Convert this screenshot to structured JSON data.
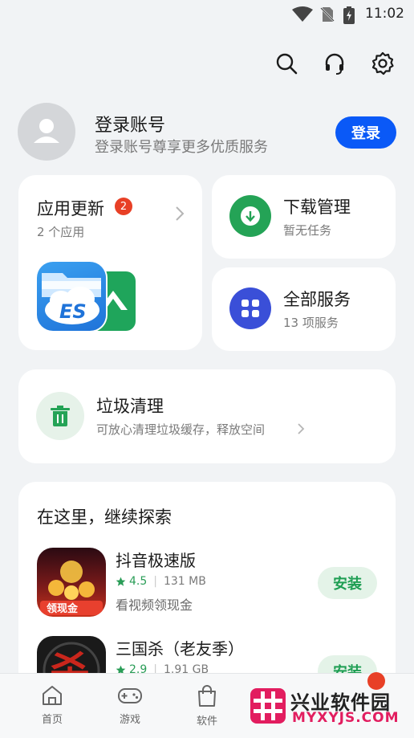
{
  "status_bar": {
    "time": "11:02"
  },
  "icons": {
    "search": "search-icon",
    "support": "headset-icon",
    "settings": "gear-icon"
  },
  "account": {
    "title": "登录账号",
    "subtitle": "登录账号尊享更多优质服务",
    "login_label": "登录"
  },
  "update_card": {
    "title": "应用更新",
    "badge": "2",
    "subtitle": "2 个应用",
    "es_logo_text": "ES"
  },
  "download_card": {
    "title": "下载管理",
    "subtitle": "暂无任务"
  },
  "services_card": {
    "title": "全部服务",
    "subtitle": "13 项服务"
  },
  "clean_card": {
    "title": "垃圾清理",
    "subtitle": "可放心清理垃圾缓存，释放空间"
  },
  "explore": {
    "title": "在这里，继续探索",
    "apps": [
      {
        "name": "抖音极速版",
        "rating": "4.5",
        "size": "131 MB",
        "desc": "看视频领现金",
        "install_label": "安装",
        "icon_text": "领现金"
      },
      {
        "name": "三国杀（老友季）",
        "rating": "2.9",
        "size": "1.91 GB",
        "desc": "",
        "install_label": "安装",
        "icon_text": "杀"
      }
    ]
  },
  "bottom_nav": {
    "items": [
      {
        "label": "首页"
      },
      {
        "label": "游戏"
      },
      {
        "label": "软件"
      }
    ]
  },
  "watermark": {
    "title": "兴业软件园",
    "url": "MYXYJS.COM"
  },
  "colors": {
    "accent": "#0a59f7",
    "green": "#1e9e53",
    "badge_red": "#e84026",
    "services_blue": "#3a4fd8"
  }
}
